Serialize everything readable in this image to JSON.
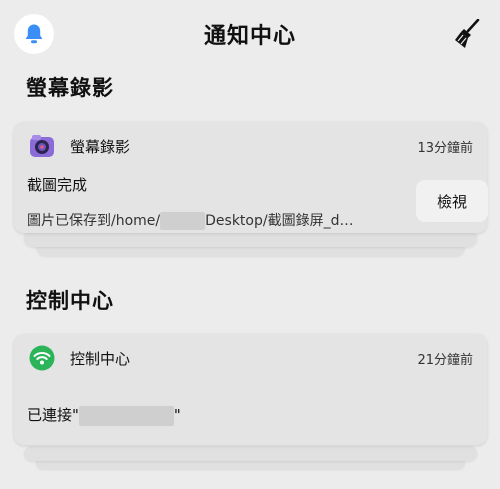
{
  "header": {
    "title": "通知中心",
    "bell_icon": "bell-icon",
    "clear_icon": "broom-icon",
    "accent_color": "#3a8ef6"
  },
  "sections": [
    {
      "title": "螢幕錄影",
      "notification": {
        "app_name": "螢幕錄影",
        "app_icon": "camera-icon",
        "time": "13分鐘前",
        "title": "截圖完成",
        "body_prefix": "圖片已保存到/home/",
        "body_suffix": "Desktop/截圖錄屏_d…",
        "action_label": "檢視"
      }
    },
    {
      "title": "控制中心",
      "notification": {
        "app_name": "控制中心",
        "app_icon": "wifi-icon",
        "time": "21分鐘前",
        "body_prefix": "已連接\"",
        "body_suffix": "\""
      }
    }
  ]
}
